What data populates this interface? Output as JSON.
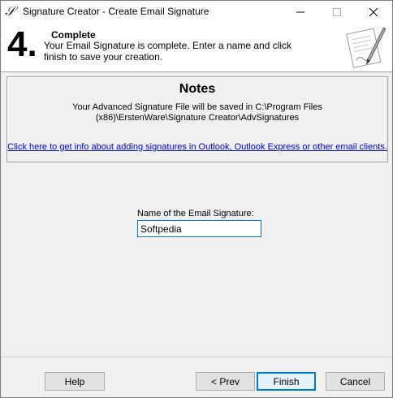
{
  "window": {
    "title": "Signature Creator - Create Email Signature"
  },
  "header": {
    "step_number": "4.",
    "step_title": "Complete",
    "step_description": "Your Email Signature is complete. Enter a name and click finish to save your creation."
  },
  "notes": {
    "title": "Notes",
    "body": "Your Advanced Signature File will be saved in C:\\Program Files (x86)\\ErstenWare\\Signature Creator\\AdvSignatures",
    "link_text": "Click here to get info about adding signatures in Outlook, Outlook Express or other email clients."
  },
  "form": {
    "name_label": "Name of the Email Signature:",
    "name_value": "Softpedia"
  },
  "buttons": {
    "help": "Help",
    "prev": "< Prev",
    "finish": "Finish",
    "cancel": "Cancel"
  },
  "colors": {
    "link": "#0000ee",
    "focus_border": "#0078d7"
  }
}
